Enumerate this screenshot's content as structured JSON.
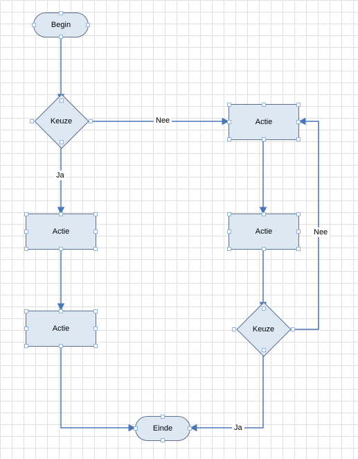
{
  "diagram": {
    "nodes": {
      "begin": {
        "type": "terminator",
        "label": "Begin"
      },
      "keuze1": {
        "type": "decision",
        "label": "Keuze"
      },
      "actieL1": {
        "type": "process",
        "label": "Actie"
      },
      "actieL2": {
        "type": "process",
        "label": "Actie"
      },
      "actieR1": {
        "type": "process",
        "label": "Actie"
      },
      "actieR2": {
        "type": "process",
        "label": "Actie"
      },
      "keuze2": {
        "type": "decision",
        "label": "Keuze"
      },
      "einde": {
        "type": "terminator",
        "label": "Einde"
      }
    },
    "edges": {
      "e_begin_keuze1": {
        "from": "begin",
        "to": "keuze1"
      },
      "e_keuze1_actieR1": {
        "from": "keuze1",
        "to": "actieR1",
        "label": "Nee"
      },
      "e_keuze1_actieL1": {
        "from": "keuze1",
        "to": "actieL1",
        "label": "Ja"
      },
      "e_actieL1_actieL2": {
        "from": "actieL1",
        "to": "actieL2"
      },
      "e_actieL2_einde": {
        "from": "actieL2",
        "to": "einde"
      },
      "e_actieR1_actieR2": {
        "from": "actieR1",
        "to": "actieR2"
      },
      "e_actieR2_keuze2": {
        "from": "actieR2",
        "to": "keuze2"
      },
      "e_keuze2_einde": {
        "from": "keuze2",
        "to": "einde",
        "label": "Ja"
      },
      "e_keuze2_actieR1": {
        "from": "keuze2",
        "to": "actieR1",
        "label": "Nee"
      }
    }
  }
}
